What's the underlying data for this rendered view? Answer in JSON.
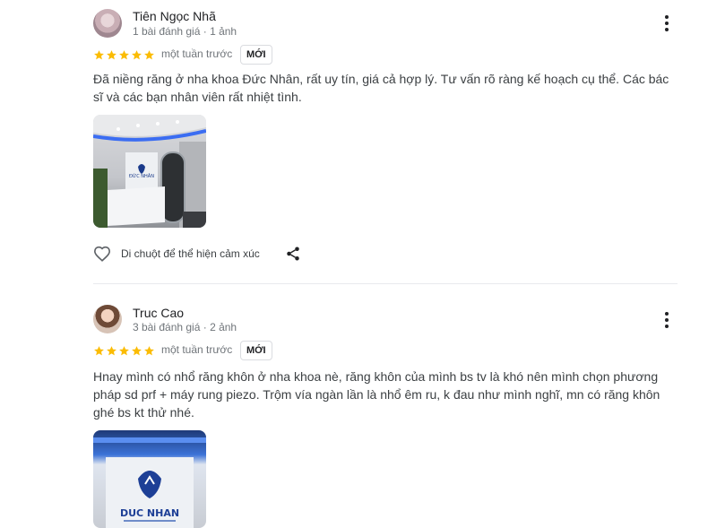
{
  "reviews": [
    {
      "author": "Tiên Ngọc Nhã",
      "meta": "1 bài đánh giá · 1 ảnh",
      "rating": 5,
      "time": "một tuần trước",
      "badge": "MỚI",
      "text": "Đã niềng răng ở nha khoa Đức Nhân, rất uy tín, giá cả hợp lý. Tư vấn rõ ràng kế hoạch cụ thể. Các bác sĩ và các bạn nhân viên rất nhiệt tình.",
      "photo_sign": "ĐỨC NHÂN",
      "reaction_label": "Di chuột để thể hiện cảm xúc"
    },
    {
      "author": "Truc Cao",
      "meta": "3 bài đánh giá · 2 ảnh",
      "rating": 5,
      "time": "một tuần trước",
      "badge": "MỚI",
      "text": "Hnay mình có nhổ răng khôn ở nha khoa nè, răng khôn của mình bs tv là khó nên mình chọn phương pháp sd prf + máy rung piezo. Trộm vía ngàn lần là nhổ êm ru, k đau như mình nghĩ, mn có răng khôn ghé bs kt thử nhé.",
      "photo_sign": "DUC NHAN"
    }
  ],
  "colors": {
    "star": "#fbbc04",
    "icon": "#5f6368",
    "divider": "#e8eaed"
  }
}
